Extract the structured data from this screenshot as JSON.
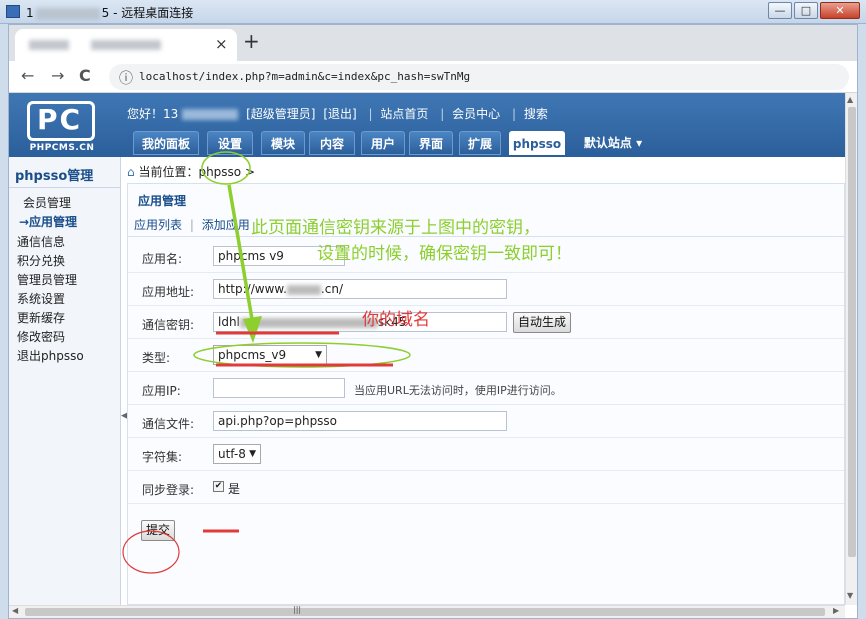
{
  "window": {
    "title_prefix": "1",
    "title_suffix": "5 - 远程桌面连接",
    "minimize": "—",
    "maximize": "□",
    "close": "✕"
  },
  "browser": {
    "tab_close": "×",
    "new_tab": "+",
    "back": "←",
    "forward": "→",
    "reload": "C",
    "info_icon": "ⓘ",
    "url": "localhost/index.php?m=admin&c=index&pc_hash=swTnMg"
  },
  "header": {
    "logo_mark": "PC",
    "logo_text": "PHPCMS.CN",
    "greeting": "您好！13",
    "role": "[超级管理员]",
    "logout": "[退出]",
    "site_home": "站点首页",
    "member_center": "会员中心",
    "search": "搜索",
    "sep": "|",
    "menu": [
      "我的面板",
      "设置",
      "模块",
      "内容",
      "用户",
      "界面",
      "扩展",
      "phpsso"
    ],
    "site_menu": "默认站点 ▾"
  },
  "sidebar": {
    "title": "phpsso管理",
    "items": [
      "会员管理",
      "→应用管理",
      "通信信息",
      "积分兑换",
      "管理员管理",
      "系统设置",
      "更新缓存",
      "修改密码",
      "退出phpsso"
    ],
    "collapse": "◀"
  },
  "main": {
    "crumb_icon": "⌂",
    "crumb": "当前位置：phpsso >",
    "section_title": "应用管理",
    "subtabs": [
      "应用列表",
      "添加应用"
    ],
    "subtab_sep": "|",
    "form": {
      "app_name_label": "应用名:",
      "app_name_value": "phpcms v9",
      "app_url_label": "应用地址:",
      "app_url_prefix": "http://www.",
      "app_url_suffix": ".cn/",
      "key_label": "通信密钥:",
      "key_prefix": "ldhl",
      "key_suffix": "sk45",
      "auto_gen": "自动生成",
      "type_label": "类型:",
      "type_value": "phpcms_v9",
      "ip_label": "应用IP:",
      "ip_value": "",
      "ip_hint": "当应用URL无法访问时，使用IP进行访问。",
      "file_label": "通信文件:",
      "file_value": "api.php?op=phpsso",
      "charset_label": "字符集:",
      "charset_value": "utf-8",
      "sync_label": "同步登录:",
      "sync_check": "✔",
      "sync_text": "是",
      "submit": "提交"
    }
  },
  "annotations": {
    "note_line1": "此页面通信密钥来源于上图中的密钥，",
    "note_line2": "设置的时候，确保密钥一致即可！",
    "domain_note": "你的域名",
    "green": "#8ccf2e",
    "red": "#e03a3a"
  },
  "scroll": {
    "up": "▲",
    "down": "▼",
    "left": "◀",
    "right": "▶",
    "grip": "|||"
  }
}
